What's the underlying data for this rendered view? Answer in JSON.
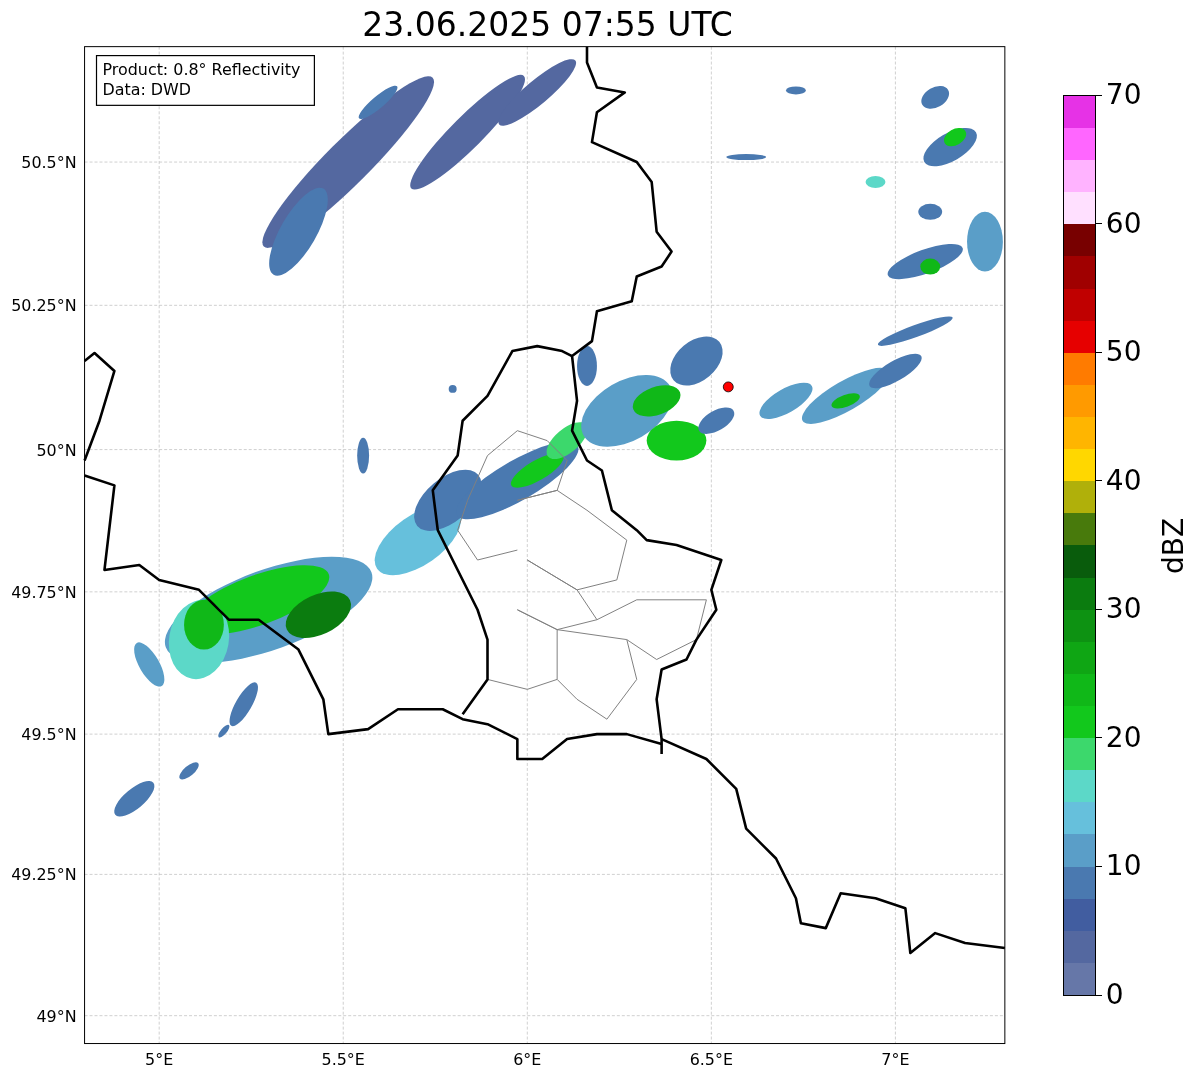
{
  "title": "23.06.2025 07:55 UTC",
  "info_box": [
    "Product: 0.8° Reflectivity",
    "Data: DWD"
  ],
  "map": {
    "lat_labels": [
      "50.5°N",
      "50.25°N",
      "50°N",
      "49.75°N",
      "49.5°N",
      "49.25°N",
      "49°N"
    ],
    "lon_labels": [
      "5°E",
      "5.5°E",
      "6°E",
      "6.5°E",
      "7°E"
    ]
  },
  "colorbar": {
    "label": "dBZ",
    "ticks": [
      "70",
      "60",
      "50",
      "40",
      "30",
      "20",
      "10",
      "0"
    ],
    "bins": [
      {
        "color": "#6677a8"
      },
      {
        "color": "#5468a0"
      },
      {
        "color": "#415da0"
      },
      {
        "color": "#4a79b0"
      },
      {
        "color": "#5a9ec8"
      },
      {
        "color": "#66c0dc"
      },
      {
        "color": "#5cd8c8"
      },
      {
        "color": "#3cd86c"
      },
      {
        "color": "#12c81c"
      },
      {
        "color": "#10b818"
      },
      {
        "color": "#0fa614"
      },
      {
        "color": "#0d9212"
      },
      {
        "color": "#0b7c0f"
      },
      {
        "color": "#095c0c"
      },
      {
        "color": "#487a0c"
      },
      {
        "color": "#b0b00a"
      },
      {
        "color": "#ffd700"
      },
      {
        "color": "#ffb500"
      },
      {
        "color": "#ff9a00"
      },
      {
        "color": "#ff7b00"
      },
      {
        "color": "#e60000"
      },
      {
        "color": "#c00000"
      },
      {
        "color": "#a00000"
      },
      {
        "color": "#780000"
      },
      {
        "color": "#ffe0ff"
      },
      {
        "color": "#ffb3ff"
      },
      {
        "color": "#ff66ff"
      },
      {
        "color": "#e632e6"
      }
    ]
  }
}
